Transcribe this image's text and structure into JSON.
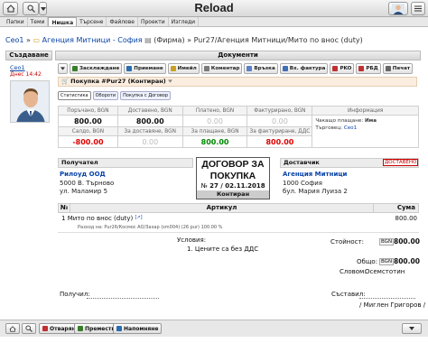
{
  "app": {
    "title": "Reload"
  },
  "menu": {
    "items": [
      "Папки",
      "Теми",
      "Нишка",
      "Търсене",
      "Файлове",
      "Проекти",
      "Изгледи"
    ],
    "active_index": 2
  },
  "breadcrumb": {
    "root": "Ceo1",
    "sep": "»",
    "company": "Агенция Митници - София",
    "company_type": "(Фирма)",
    "path_rest": "Pur27/Агенция Митници/Мито по внос (duty)"
  },
  "left": {
    "header": "Създаване",
    "creator": "Ceo1",
    "date": "Днес 14:42"
  },
  "docs": {
    "header": "Документи",
    "toolbar": [
      {
        "label": "Засклаждане",
        "color": "#3a7d2a"
      },
      {
        "label": "Приемане",
        "color": "#2a6db0"
      },
      {
        "label": "Имейл",
        "color": "#c9a020"
      },
      {
        "label": "Коментар",
        "color": "#7a7a7a"
      },
      {
        "label": "Връзка",
        "color": "#5b80c8"
      },
      {
        "label": "Вх. фактура",
        "color": "#3f6fb5"
      },
      {
        "label": "PKO",
        "color": "#c03030"
      },
      {
        "label": "РБД",
        "color": "#c03030"
      },
      {
        "label": "Печат",
        "color": "#666666"
      }
    ],
    "doc_label": "Покупка #Pur27 (Контиран)",
    "subtabs": [
      "Статистика",
      "Обороти",
      "Покупка с Договор"
    ]
  },
  "summary": {
    "headers1": [
      "Поръчано, BGN",
      "Доставено, BGN",
      "Платено, BGN",
      "Фактурирано, BGN",
      "Информация"
    ],
    "values1": [
      "800.00",
      "800.00",
      "0.00",
      "0.00"
    ],
    "headers2": [
      "Салдо, BGN",
      "За доставяне, BGN",
      "За плащане, BGN",
      "За фактуриране, ДДС"
    ],
    "values2": [
      "-800.00",
      "0.00",
      "800.00",
      "800.00"
    ],
    "info_pay_label": "Чакащо плащане:",
    "info_pay_value": "Има",
    "info_dealer_label": "Търговец:",
    "info_dealer_value": "Ceo1"
  },
  "recipient": {
    "header": "Получател",
    "name": "Рилоуд ООД",
    "line1": "5000 В. Търново",
    "line2": "ул. Маламир 5"
  },
  "contract": {
    "title_line1": "ДОГОВОР ЗА",
    "title_line2": "ПОКУПКА",
    "number_label": "№",
    "number": "27 / 02.11.2018",
    "status": "Контиран"
  },
  "supplier": {
    "header": "Доставчик",
    "badge": "ДОСТАВЕНО",
    "name": "Агенция Митници",
    "line1": "1000 София",
    "line2": "бул. Мария Луиза 2"
  },
  "items": {
    "col_num": "№",
    "col_article": "Артикул",
    "col_sum": "Сума",
    "rows": [
      {
        "num": "1",
        "name": "Мито по внос (duty)",
        "sub": "Разход на: Pur26/Космос АО/Захар (sm004) (26 pur) 100.00 %",
        "amount": "800.00"
      }
    ]
  },
  "totals": {
    "conditions_label": "Условия:",
    "conditions": [
      "1. Цените са без ДДС"
    ],
    "value_label": "Стойност:",
    "value": "800.00",
    "total_label": "Общо:",
    "total": "800.00",
    "currency": "BGN",
    "words_label": "Словом:",
    "words": "Осемстотин"
  },
  "signatures": {
    "received_label": "Получил:",
    "composed_label": "Съставил:",
    "composed_name": "/ Миглен Григоров /"
  },
  "bottom": {
    "buttons": [
      {
        "label": "Отваряне",
        "color": "#c03030"
      },
      {
        "label": "Преместване",
        "color": "#3a7d2a"
      },
      {
        "label": "Напомняне",
        "color": "#2a6db0"
      }
    ]
  }
}
